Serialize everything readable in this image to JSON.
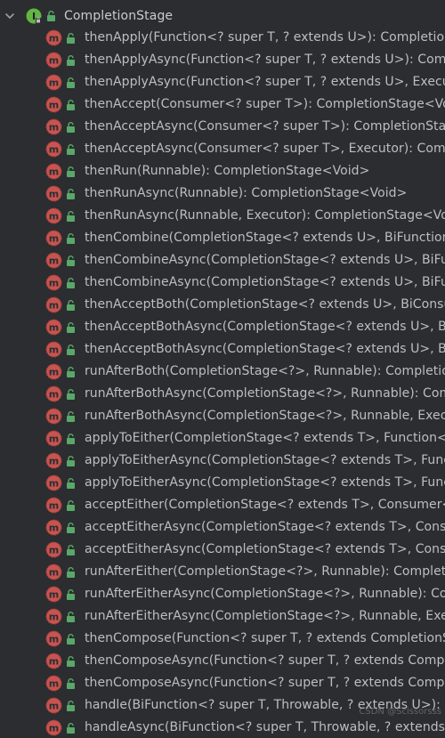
{
  "tree": {
    "root": {
      "label": "CompletionStage",
      "icon": "interface-icon",
      "expanded": true
    },
    "methods": [
      "thenApply(Function<? super T, ? extends U>): CompletionS",
      "thenApplyAsync(Function<? super T, ? extends U>): Comple",
      "thenApplyAsync(Function<? super T, ? extends U>, Executo",
      "thenAccept(Consumer<? super T>): CompletionStage<Void",
      "thenAcceptAsync(Consumer<? super T>): CompletionStage",
      "thenAcceptAsync(Consumer<? super T>, Executor): Comple",
      "thenRun(Runnable): CompletionStage<Void>",
      "thenRunAsync(Runnable): CompletionStage<Void>",
      "thenRunAsync(Runnable, Executor): CompletionStage<Void",
      "thenCombine(CompletionStage<? extends U>, BiFunction<?",
      "thenCombineAsync(CompletionStage<? extends U>, BiFunc",
      "thenCombineAsync(CompletionStage<? extends U>, BiFunc",
      "thenAcceptBoth(CompletionStage<? extends U>, BiConsum",
      "thenAcceptBothAsync(CompletionStage<? extends U>, BiCo",
      "thenAcceptBothAsync(CompletionStage<? extends U>, BiCo",
      "runAfterBoth(CompletionStage<?>, Runnable): CompletionS",
      "runAfterBothAsync(CompletionStage<?>, Runnable): Compl",
      "runAfterBothAsync(CompletionStage<?>, Runnable, Executo",
      "applyToEither(CompletionStage<? extends T>, Function<? s",
      "applyToEitherAsync(CompletionStage<? extends T>, Functio",
      "applyToEitherAsync(CompletionStage<? extends T>, Functio",
      "acceptEither(CompletionStage<? extends T>, Consumer<? s",
      "acceptEitherAsync(CompletionStage<? extends T>, Consum",
      "acceptEitherAsync(CompletionStage<? extends T>, Consum",
      "runAfterEither(CompletionStage<?>, Runnable): Completion",
      "runAfterEitherAsync(CompletionStage<?>, Runnable): Comp",
      "runAfterEitherAsync(CompletionStage<?>, Runnable, Execu",
      "thenCompose(Function<? super T, ? extends CompletionSta",
      "thenComposeAsync(Function<? super T, ? extends Complet",
      "thenComposeAsync(Function<? super T, ? extends Complet",
      "handle(BiFunction<? super T, Throwable, ? extends U>): Co",
      "handleAsync(BiFunction<? super T, Throwable, ? extends U>"
    ],
    "method_icon": "abstract-method-icon",
    "visibility_icon": "public-lock-icon"
  },
  "colors": {
    "background": "#2b2d30",
    "text": "#bcbec4",
    "method_icon": "#c75450",
    "interface_icon": "#62b543",
    "lock": "#59a869"
  },
  "watermark": "CSDN @Scissorsss"
}
